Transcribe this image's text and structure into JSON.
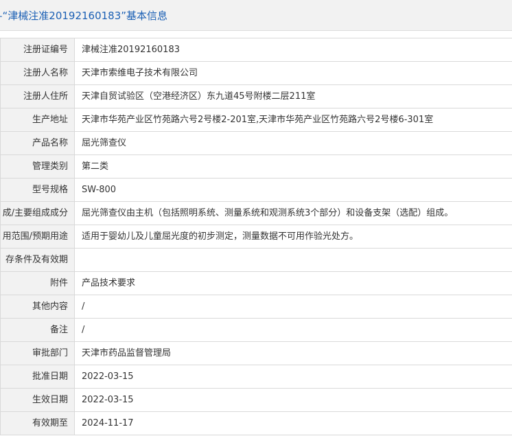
{
  "header": {
    "title": "–“津械注准20192160183”基本信息"
  },
  "rows": [
    {
      "label": "注册证编号",
      "value": "津械注准20192160183"
    },
    {
      "label": "注册人名称",
      "value": "天津市索维电子技术有限公司"
    },
    {
      "label": "注册人住所",
      "value": "天津自贸试验区（空港经济区）东九道45号附楼二层211室"
    },
    {
      "label": "生产地址",
      "value": "天津市华苑产业区竹苑路六号2号楼2-201室,天津市华苑产业区竹苑路六号2号楼6-301室"
    },
    {
      "label": "产品名称",
      "value": "屈光筛查仪"
    },
    {
      "label": "管理类别",
      "value": "第二类"
    },
    {
      "label": "型号规格",
      "value": "SW-800"
    },
    {
      "label": "成/主要组成成分",
      "value": "屈光筛查仪由主机（包括照明系统、测量系统和观测系统3个部分）和设备支架（选配）组成。"
    },
    {
      "label": "用范围/预期用途",
      "value": "适用于婴幼儿及儿童屈光度的初步测定，测量数据不可用作验光处方。"
    },
    {
      "label": "存条件及有效期",
      "value": ""
    },
    {
      "label": "附件",
      "value": "产品技术要求"
    },
    {
      "label": "其他内容",
      "value": "/"
    },
    {
      "label": "备注",
      "value": "/"
    },
    {
      "label": "审批部门",
      "value": "天津市药品监督管理局"
    },
    {
      "label": "批准日期",
      "value": "2022-03-15"
    },
    {
      "label": "生效日期",
      "value": "2022-03-15"
    },
    {
      "label": "有效期至",
      "value": "2024-11-17"
    }
  ]
}
